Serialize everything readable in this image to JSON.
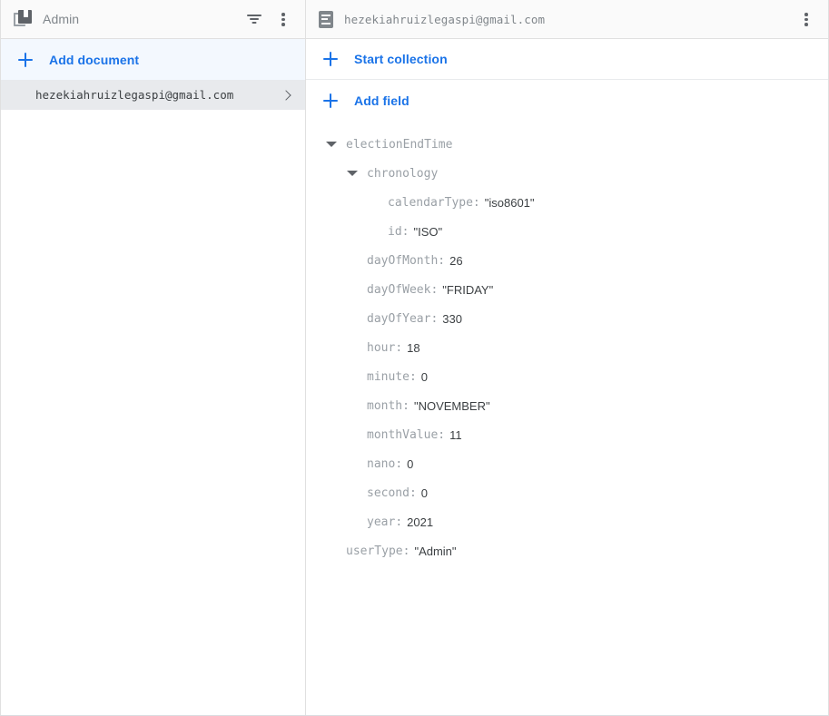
{
  "collections_panel": {
    "header": {
      "icon": "collection-icon",
      "title": "Admin",
      "filter_icon": "filter-icon",
      "more_icon": "more-vert-icon"
    },
    "add_document": {
      "icon": "plus-icon",
      "label": "Add document"
    },
    "documents": [
      {
        "id": "hezekiahruizlegaspi@gmail.com",
        "selected": true,
        "chevron_icon": "chevron-right-icon"
      }
    ]
  },
  "document_panel": {
    "header": {
      "icon": "document-icon",
      "title": "hezekiahruizlegaspi@gmail.com",
      "more_icon": "more-vert-icon"
    },
    "start_collection": {
      "icon": "plus-icon",
      "label": "Start collection"
    },
    "add_field": {
      "icon": "plus-icon",
      "label": "Add field"
    },
    "fields": [
      {
        "key": "electionEndTime",
        "sep": "",
        "value": "",
        "indent": 0,
        "caret": true,
        "caret_icon": "caret-down-icon"
      },
      {
        "key": "chronology",
        "sep": "",
        "value": "",
        "indent": 1,
        "caret": true,
        "caret_icon": "caret-down-icon"
      },
      {
        "key": "calendarType",
        "sep": ":",
        "value": "\"iso8601\"",
        "indent": 2,
        "caret": false
      },
      {
        "key": "id",
        "sep": ":",
        "value": "\"ISO\"",
        "indent": 2,
        "caret": false
      },
      {
        "key": "dayOfMonth",
        "sep": ":",
        "value": "26",
        "indent": 1,
        "caret": false
      },
      {
        "key": "dayOfWeek",
        "sep": ":",
        "value": "\"FRIDAY\"",
        "indent": 1,
        "caret": false
      },
      {
        "key": "dayOfYear",
        "sep": ":",
        "value": "330",
        "indent": 1,
        "caret": false
      },
      {
        "key": "hour",
        "sep": ":",
        "value": "18",
        "indent": 1,
        "caret": false
      },
      {
        "key": "minute",
        "sep": ":",
        "value": "0",
        "indent": 1,
        "caret": false
      },
      {
        "key": "month",
        "sep": ":",
        "value": "\"NOVEMBER\"",
        "indent": 1,
        "caret": false
      },
      {
        "key": "monthValue",
        "sep": ":",
        "value": "11",
        "indent": 1,
        "caret": false
      },
      {
        "key": "nano",
        "sep": ":",
        "value": "0",
        "indent": 1,
        "caret": false
      },
      {
        "key": "second",
        "sep": ":",
        "value": "0",
        "indent": 1,
        "caret": false
      },
      {
        "key": "year",
        "sep": ":",
        "value": "2021",
        "indent": 1,
        "caret": false
      },
      {
        "key": "userType",
        "sep": ":",
        "value": "\"Admin\"",
        "indent": 0,
        "caret": false
      }
    ]
  },
  "colors": {
    "accent_blue": "#1a73e8",
    "header_bg": "#fafafa",
    "selected_row_bg": "#e8eaed",
    "add_row_bg": "#f3f8fe",
    "key_gray": "#9aa0a6",
    "value_gray": "#3c4043",
    "border": "#e0e0e0"
  }
}
